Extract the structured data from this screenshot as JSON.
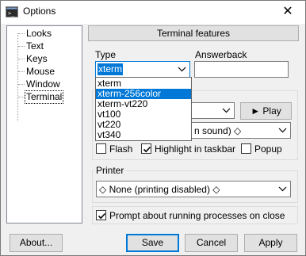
{
  "window": {
    "title": "Options",
    "close_glyph": "✕"
  },
  "tree": {
    "items": [
      {
        "label": "Looks"
      },
      {
        "label": "Text"
      },
      {
        "label": "Keys"
      },
      {
        "label": "Mouse"
      },
      {
        "label": "Window"
      },
      {
        "label": "Terminal",
        "selected": true
      }
    ]
  },
  "panel": {
    "header": "Terminal features",
    "type_label": "Type",
    "type_value": "xterm",
    "answerback_label": "Answerback",
    "answerback_value": "",
    "type_options": [
      "xterm",
      "xterm-256color",
      "xterm-vt220",
      "vt100",
      "vt220",
      "vt340"
    ],
    "type_highlighted": "xterm-256color",
    "bell_group_prefix": "B",
    "bell_sound_tail": "n sound) ◇",
    "play_button": "► Play",
    "flash_label": "Flash",
    "highlight_label": "Highlight in taskbar",
    "popup_label": "Popup",
    "flash_checked": false,
    "highlight_checked": true,
    "popup_checked": false,
    "printer_label": "Printer",
    "printer_value": "◇ None (printing disabled) ◇",
    "prompt_label": "Prompt about running processes on close",
    "prompt_checked": true
  },
  "buttons": {
    "about": "About...",
    "save": "Save",
    "cancel": "Cancel",
    "apply": "Apply"
  },
  "colors": {
    "accent": "#0078d7",
    "highlight_bg": "#0078d7"
  }
}
